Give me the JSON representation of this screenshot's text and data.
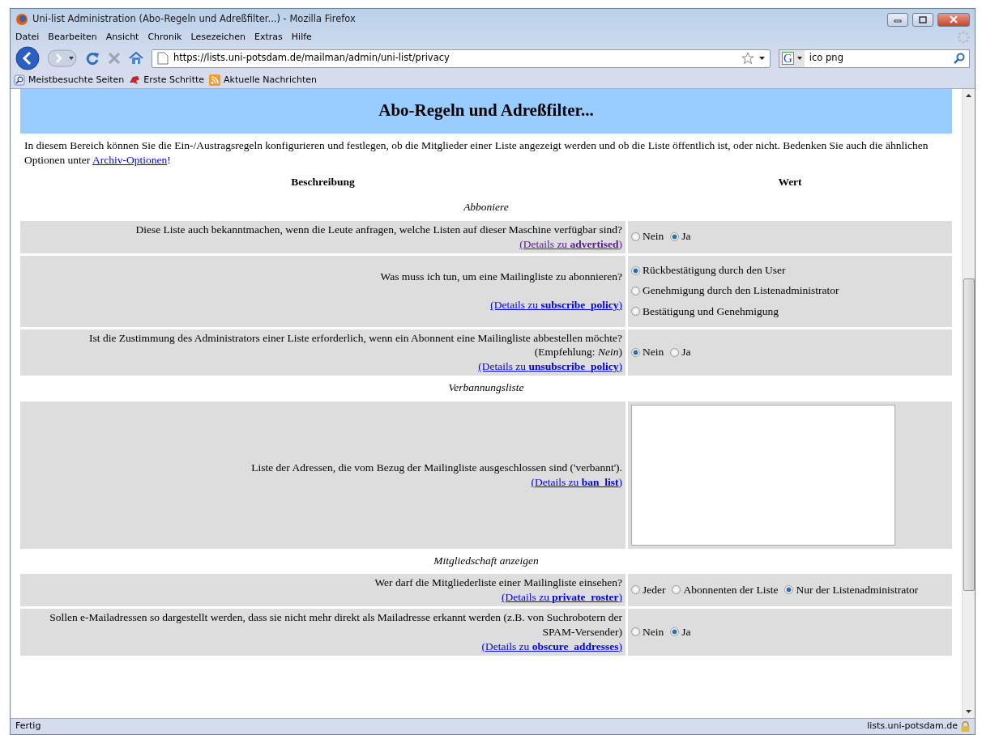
{
  "window": {
    "title": "Uni-list Administration (Abo-Regeln und Adreßfilter...) - Mozilla Firefox"
  },
  "menu": [
    "Datei",
    "Bearbeiten",
    "Ansicht",
    "Chronik",
    "Lesezeichen",
    "Extras",
    "Hilfe"
  ],
  "toolbar": {
    "url": "https://lists.uni-potsdam.de/mailman/admin/uni-list/privacy",
    "search": "ico png",
    "engine": "G"
  },
  "bookmarks": [
    {
      "label": "Meistbesuchte Seiten",
      "kind": "magnifier"
    },
    {
      "label": "Erste Schritte",
      "kind": "dino"
    },
    {
      "label": "Aktuelle Nachrichten",
      "kind": "feed"
    }
  ],
  "page": {
    "heading": "Abo-Regeln und Adreßfilter...",
    "intro": {
      "text": "In diesem Bereich können Sie die Ein-/Austragsregeln konfigurieren und festlegen, ob die Mitglieder einer Liste angezeigt werden und ob die Liste öffentlich ist, oder nicht. Bedenken Sie auch die ähnlichen Optionen unter ",
      "link": "Archiv-Optionen",
      "after": "!"
    },
    "columns": [
      "Beschreibung",
      "Wert"
    ],
    "sections": [
      {
        "title": "Abboniere",
        "rows": [
          {
            "description": "Diese Liste auch bekanntmachen, wenn die Leute anfragen, welche Listen auf dieser Maschine verfügbar sind?",
            "details": "(Details zu **advertised**)",
            "visited": true,
            "control": {
              "kind": "radio_inline",
              "options": [
                {
                  "label": "Nein",
                  "selected": false
                },
                {
                  "label": "Ja",
                  "selected": true
                }
              ]
            }
          },
          {
            "description": "Was muss ich tun, um eine Mailingliste zu abonnieren?",
            "details": "(Details zu **subscribe_policy**)",
            "visited": false,
            "control": {
              "kind": "radio_stacked",
              "options": [
                {
                  "label": "Rückbestätigung durch den User",
                  "selected": true
                },
                {
                  "label": "Genehmigung durch den Listenadministrator",
                  "selected": false
                },
                {
                  "label": "Bestätigung und Genehmigung",
                  "selected": false
                }
              ]
            }
          },
          {
            "description": "Ist die Zustimmung des Administrators einer Liste erforderlich, wenn ein Abonnent eine Mailingliste abbestellen möchte?",
            "note": "(Empfehlung: *Nein*)",
            "details": "(Details zu **unsubscribe_policy**)",
            "visited": false,
            "control": {
              "kind": "radio_inline",
              "options": [
                {
                  "label": "Nein",
                  "selected": true
                },
                {
                  "label": "Ja",
                  "selected": false
                }
              ]
            }
          }
        ]
      },
      {
        "title": "Verbannungsliste",
        "rows": [
          {
            "description": "Liste der Adressen, die vom Bezug der Mailingliste ausgeschlossen sind ('verbannt').",
            "details": "(Details zu **ban_list**)",
            "visited": false,
            "control": {
              "kind": "textarea"
            }
          }
        ]
      },
      {
        "title": "Mitgliedschaft anzeigen",
        "rows": [
          {
            "description": "Wer darf die Mitgliederliste einer Mailingliste einsehen?",
            "details": "(Details zu **private_roster**)",
            "visited": false,
            "control": {
              "kind": "radio_inline",
              "options": [
                {
                  "label": "Jeder",
                  "selected": false
                },
                {
                  "label": "Abonnenten der Liste",
                  "selected": false
                },
                {
                  "label": "Nur der Listenadministrator",
                  "selected": true
                }
              ]
            }
          },
          {
            "description": "Sollen e-Mailadressen so dargestellt werden, dass sie nicht mehr direkt als Mailadresse erkannt werden (z.B. von Suchrobotern der SPAM-Versender)",
            "details": "(Details zu **obscure_addresses**)",
            "visited": false,
            "control": {
              "kind": "radio_inline",
              "options": [
                {
                  "label": "Nein",
                  "selected": false
                },
                {
                  "label": "Ja",
                  "selected": true
                }
              ]
            }
          }
        ]
      }
    ]
  },
  "status_bar": {
    "text": "Fertig",
    "host": "lists.uni-potsdam.de"
  }
}
